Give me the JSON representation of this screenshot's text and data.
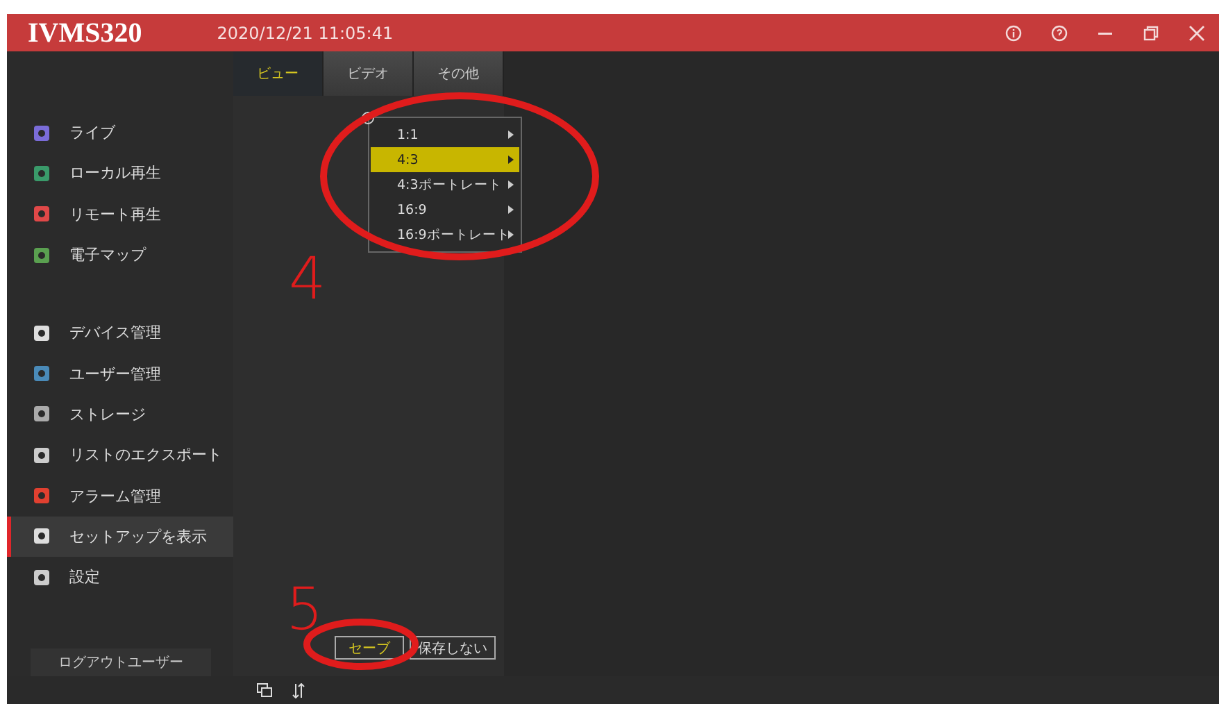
{
  "window": {
    "title": "IVMS320",
    "datetime": "2020/12/21 11:05:41"
  },
  "sidebar": {
    "groups": [
      [
        {
          "label": "ライブ",
          "selected": false
        },
        {
          "label": "ローカル再生",
          "selected": false
        },
        {
          "label": "リモート再生",
          "selected": false
        },
        {
          "label": "電子マップ",
          "selected": false
        }
      ],
      [
        {
          "label": "デバイス管理",
          "selected": false
        },
        {
          "label": "ユーザー管理",
          "selected": false
        },
        {
          "label": "ストレージ",
          "selected": false
        },
        {
          "label": "リストのエクスポート",
          "selected": false
        },
        {
          "label": "アラーム管理",
          "selected": false
        },
        {
          "label": "セットアップを表示",
          "selected": true
        },
        {
          "label": "設定",
          "selected": false
        }
      ]
    ],
    "logout": "ログアウトユーザー"
  },
  "tabs": [
    {
      "label": "ビュー",
      "selected": true
    },
    {
      "label": "ビデオ",
      "selected": false
    },
    {
      "label": "その他",
      "selected": false
    }
  ],
  "menu": [
    {
      "label": "1:1",
      "selected": false
    },
    {
      "label": "4:3",
      "selected": true
    },
    {
      "label": "4:3ポートレート",
      "selected": false
    },
    {
      "label": "16:9",
      "selected": false
    },
    {
      "label": "16:9ポートレート",
      "selected": false
    }
  ],
  "buttons": [
    {
      "label": "セーブ",
      "kind": "primary"
    },
    {
      "label": "保存しない",
      "kind": "plain"
    }
  ],
  "annotations": [
    "4",
    "5"
  ]
}
